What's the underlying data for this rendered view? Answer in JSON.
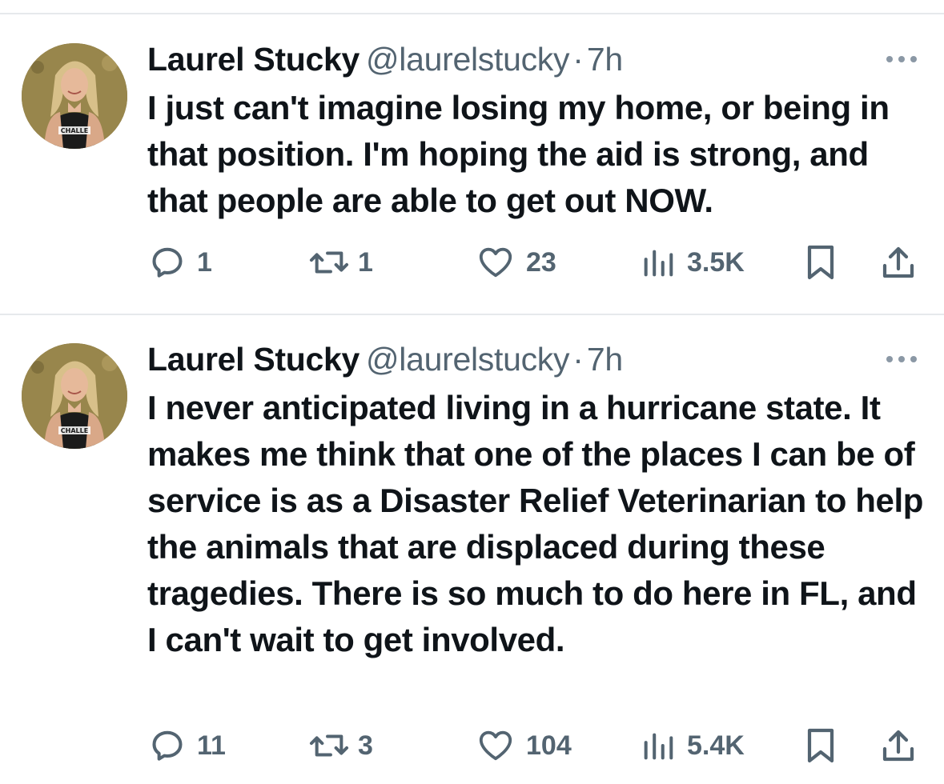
{
  "tweets": [
    {
      "author": {
        "name": "Laurel Stucky",
        "handle": "@laurelstucky",
        "avatar_icon": "profile-photo-avatar"
      },
      "separator": "·",
      "time": "7h",
      "text": "I just can't imagine losing my home, or being in that position. I'm hoping the aid is strong, and that people are able to get out NOW.",
      "stats": {
        "replies": "1",
        "reposts": "1",
        "likes": "23",
        "views": "3.5K"
      }
    },
    {
      "author": {
        "name": "Laurel Stucky",
        "handle": "@laurelstucky",
        "avatar_icon": "profile-photo-avatar"
      },
      "separator": "·",
      "time": "7h",
      "text": "I never anticipated living in a hurricane state. It makes me think that one of the places I can be of service is as a Disaster Relief Veterinarian to help the animals that are displaced during these tragedies. There is so much to do here in FL, and I can't wait to get involved.",
      "stats": {
        "replies": "11",
        "reposts": "3",
        "likes": "104",
        "views": "5.4K"
      }
    }
  ],
  "icons": {
    "reply": "reply-icon",
    "repost": "repost-icon",
    "like": "heart-icon",
    "views": "views-chart-icon",
    "bookmark": "bookmark-icon",
    "share": "share-icon",
    "more": "more-dots-icon"
  },
  "colors": {
    "text_primary": "#0f1419",
    "text_secondary": "#536471",
    "divider": "#e6e9ec"
  }
}
